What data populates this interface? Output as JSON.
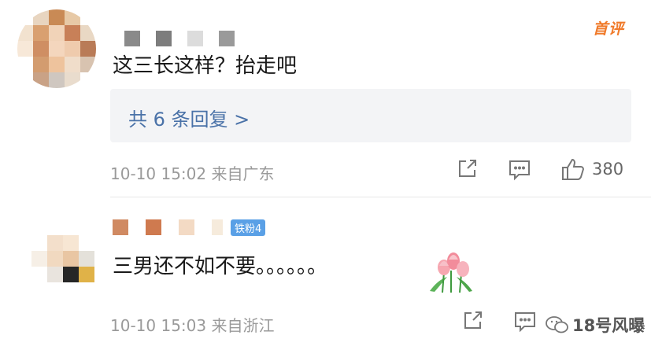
{
  "comment1": {
    "badge": "首评",
    "text": "这三长这样？抬走吧",
    "replies_label": "共 6 条回复 >",
    "timestamp": "10-10 15:02",
    "location": "来自广东",
    "like_count": "380"
  },
  "comment2": {
    "fan_badge": "铁粉4",
    "text": "三男还不如不要。。。。。。",
    "timestamp": "10-10 15:03",
    "location": "来自浙江"
  },
  "watermark": {
    "text": "18号风曝"
  },
  "icons": [
    "share-icon",
    "comment-icon",
    "like-icon",
    "wechat-icon",
    "tulip-sticker"
  ]
}
